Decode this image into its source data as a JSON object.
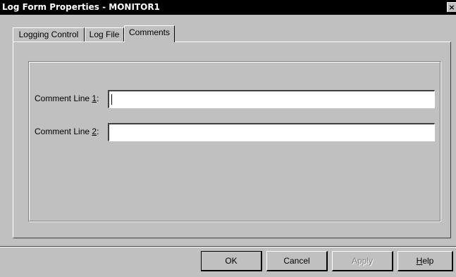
{
  "window": {
    "title": "Log Form Properties - MONITOR1",
    "close_glyph": "×"
  },
  "tabs": [
    {
      "label": "Logging Control",
      "active": false
    },
    {
      "label": "Log File",
      "active": false
    },
    {
      "label": "Comments",
      "active": true
    }
  ],
  "comments": {
    "line1": {
      "label_prefix": "Comment Line ",
      "label_key": "1",
      "label_suffix": ":",
      "value": ""
    },
    "line2": {
      "label_prefix": "Comment Line ",
      "label_key": "2",
      "label_suffix": ":",
      "value": ""
    }
  },
  "buttons": {
    "ok": "OK",
    "cancel": "Cancel",
    "apply": "Apply",
    "help_key": "H",
    "help_rest": "elp"
  }
}
